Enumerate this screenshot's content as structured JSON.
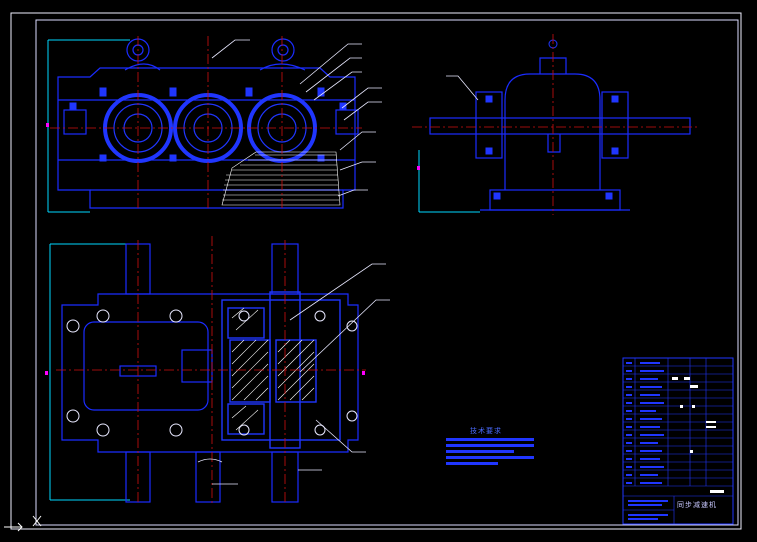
{
  "drawing": {
    "technical_requirements_title": "技术要求",
    "title_block_name": "同步减速机"
  },
  "colors": {
    "background": "#000000",
    "outline": "#1a2cff",
    "gear": "#2036ff",
    "centerline": "#d01010",
    "dimension": "#00d8ff",
    "leader": "#e8e8ff",
    "border": "#f0f0ff",
    "magenta": "#ff00ff"
  }
}
